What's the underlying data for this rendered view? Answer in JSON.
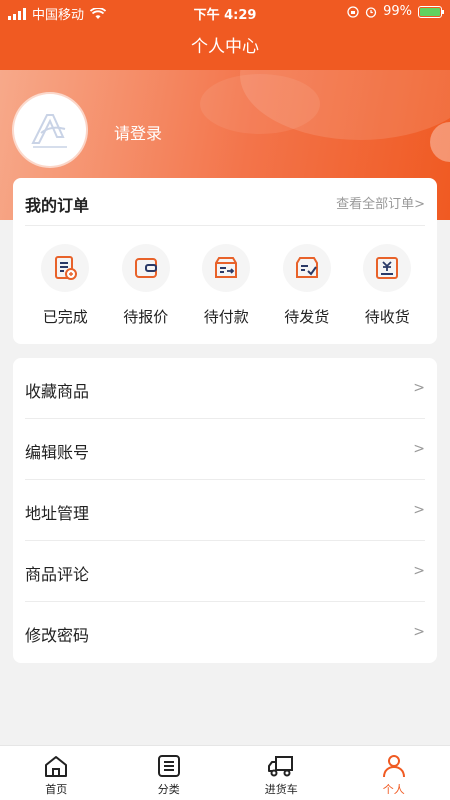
{
  "status_bar": {
    "carrier": "中国移动",
    "time": "下午 4:29",
    "battery": "99%",
    "battery_level": 0.99
  },
  "nav": {
    "title": "个人中心"
  },
  "profile": {
    "login_label": "请登录"
  },
  "orders": {
    "title": "我的订单",
    "view_all": "查看全部订单>",
    "items": [
      {
        "label": "已完成",
        "icon": "completed-order-icon"
      },
      {
        "label": "待报价",
        "icon": "wallet-icon"
      },
      {
        "label": "待付款",
        "icon": "payment-icon"
      },
      {
        "label": "待发货",
        "icon": "shipping-icon"
      },
      {
        "label": "待收货",
        "icon": "receive-icon"
      }
    ]
  },
  "menu": {
    "items": [
      {
        "label": "收藏商品",
        "arrow": ">"
      },
      {
        "label": "编辑账号",
        "arrow": ">"
      },
      {
        "label": "地址管理",
        "arrow": ">"
      },
      {
        "label": "商品评论",
        "arrow": ">"
      },
      {
        "label": "修改密码",
        "arrow": ">"
      }
    ]
  },
  "tabbar": {
    "items": [
      {
        "label": "首页",
        "icon": "home-icon"
      },
      {
        "label": "分类",
        "icon": "category-icon"
      },
      {
        "label": "进货车",
        "icon": "truck-icon"
      },
      {
        "label": "个人",
        "icon": "person-icon"
      }
    ],
    "active": "个人"
  },
  "colors": {
    "accent": "#f05a22",
    "icon_orange": "#e8622a",
    "icon_navy": "#2b3a67"
  }
}
